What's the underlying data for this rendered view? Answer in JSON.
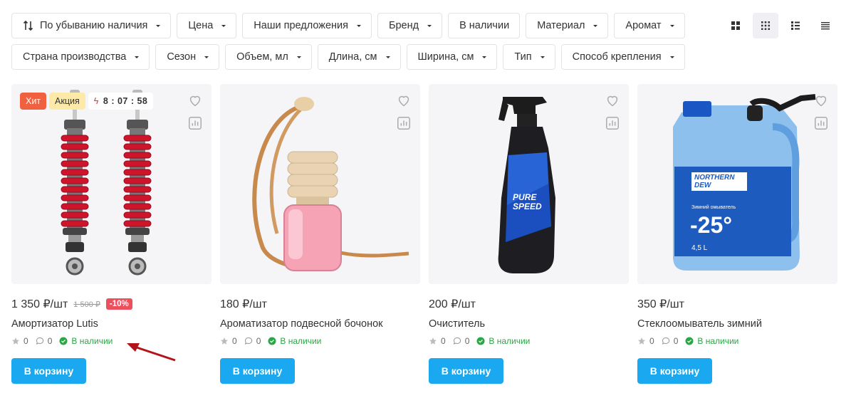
{
  "sort": {
    "label": "По убыванию наличия"
  },
  "filters_row1": [
    "Цена",
    "Наши предложения",
    "Бренд",
    "В наличии",
    "Материал",
    "Аромат"
  ],
  "filters_row2": [
    "Страна производства",
    "Сезон",
    "Объем, мл",
    "Длина, см",
    "Ширина, см",
    "Тип",
    "Способ крепления"
  ],
  "view_modes": [
    "grid-large-icon",
    "grid-small-icon",
    "list-icon",
    "table-icon"
  ],
  "products": [
    {
      "price": "1 350 ₽/шт",
      "old_price": "1 500 ₽",
      "discount": "-10%",
      "name": "Амортизатор Lutis",
      "rating": "0",
      "reviews": "0",
      "stock": "В наличии",
      "badges": {
        "hit": "Хит",
        "sale": "Акция",
        "timer": "8 : 07 : 58"
      },
      "cart": "В корзину"
    },
    {
      "price": "180 ₽/шт",
      "name": "Ароматизатор подвесной бочонок",
      "rating": "0",
      "reviews": "0",
      "stock": "В наличии",
      "cart": "В корзину"
    },
    {
      "price": "200 ₽/шт",
      "name": "Очиститель",
      "rating": "0",
      "reviews": "0",
      "stock": "В наличии",
      "cart": "В корзину",
      "label_text": "PURE SPEED"
    },
    {
      "price": "350 ₽/шт",
      "name": "Стеклоомыватель зимний",
      "rating": "0",
      "reviews": "0",
      "stock": "В наличии",
      "cart": "В корзину",
      "label_brand": "NORTHERN DEW",
      "label_sub": "Зимний омыватель",
      "label_temp": "-25°",
      "label_volume": "4,5 L"
    }
  ],
  "colors": {
    "accent": "#1aa8f0",
    "stock_green": "#28a745",
    "hit": "#f2613f",
    "sale": "#fde9a8",
    "discount": "#ee4f5d"
  }
}
